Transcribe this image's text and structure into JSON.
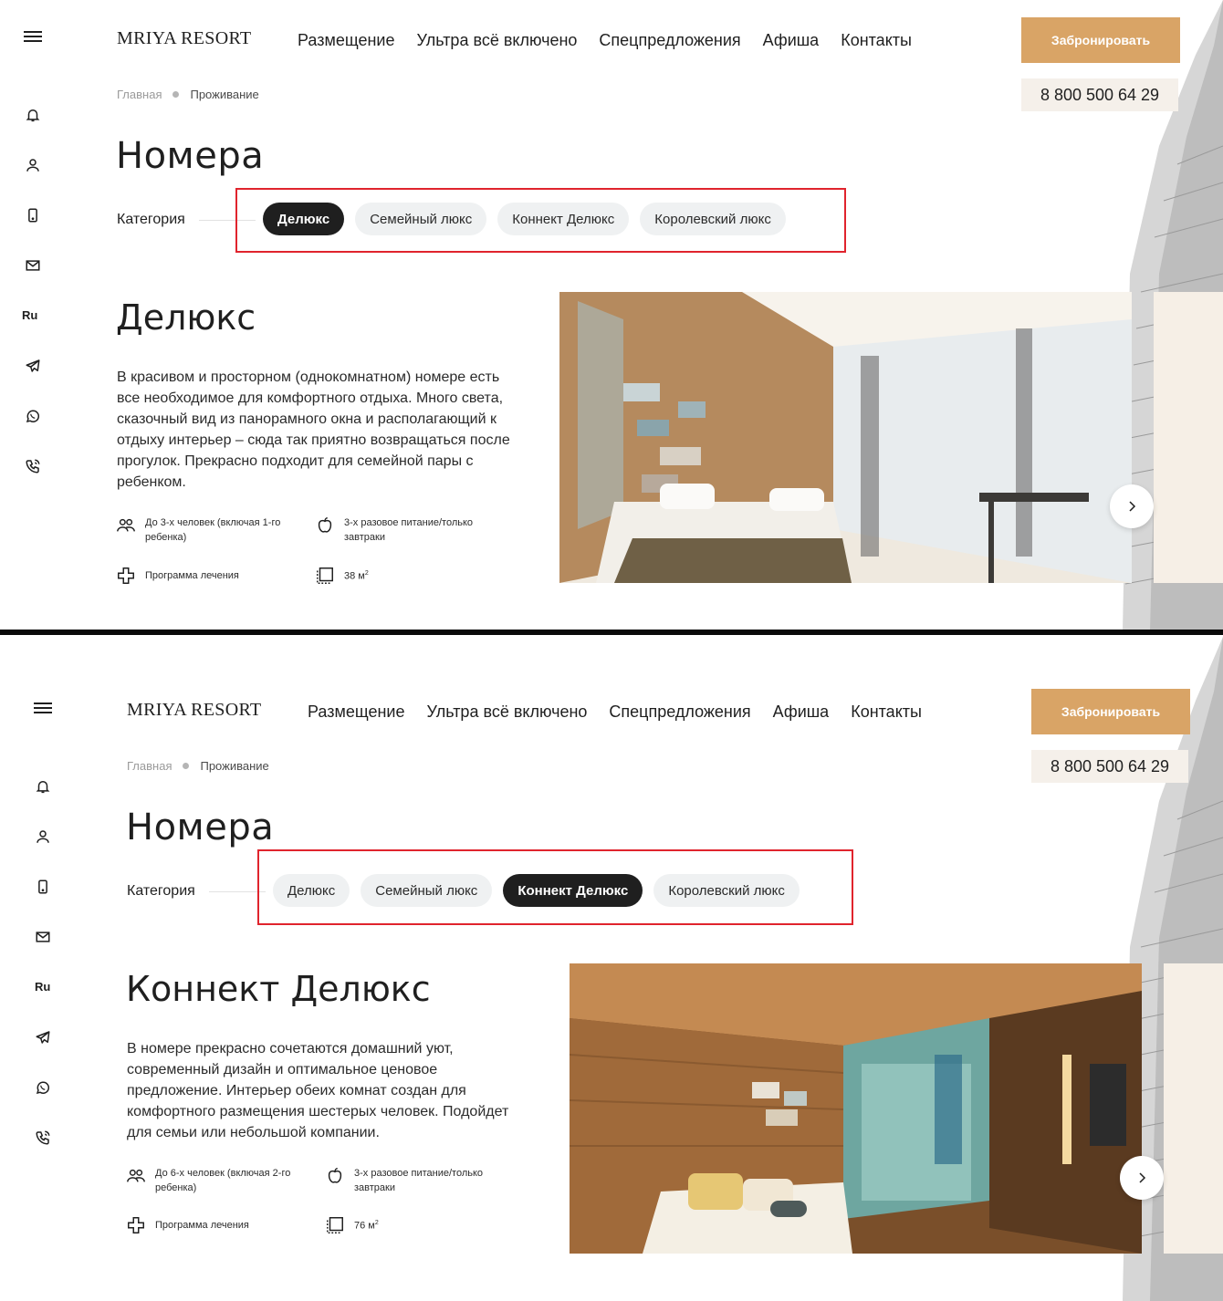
{
  "rail": {
    "lang": "Ru",
    "icons": [
      "menu-icon",
      "bell-icon",
      "user-icon",
      "mobile-icon",
      "mail-icon",
      "telegram-icon",
      "whatsapp-icon",
      "phone-call-icon"
    ]
  },
  "header": {
    "logo": "MRIYA RESORT",
    "nav": [
      "Размещение",
      "Ультра всё включено",
      "Спецпредложения",
      "Афиша",
      "Контакты"
    ],
    "book_label": "Забронировать",
    "phone": "8 800 500 64 29"
  },
  "breadcrumb": {
    "home": "Главная",
    "current": "Проживание"
  },
  "page_title": "Номера",
  "category_label": "Категория",
  "categories": [
    "Делюкс",
    "Семейный люкс",
    "Коннект Делюкс",
    "Королевский люкс"
  ],
  "colors": {
    "accent": "#d9a466",
    "active_pill": "#1f1f1f",
    "pill": "#eff1f2",
    "highlight": "#e0242d",
    "cream": "#f6efe6"
  },
  "screens": [
    {
      "active_category": "Делюкс",
      "room": {
        "title": "Делюкс",
        "description": "В красивом и просторном (однокомнатном) номере есть все необходимое для комфортного отдыха. Много света, сказочный вид из панорамного окна и располагающий к отдыху интерьер – сюда так приятно возвращаться после прогулок. Прекрасно подходит для семейной пары с ребенком.",
        "features": {
          "guests": "До 3-х человек (включая 1-го ребенка)",
          "meals": "3-х разовое питание/только завтраки",
          "program": "Программа лечения",
          "area": "38 м",
          "area_unit_sup": "2"
        }
      }
    },
    {
      "active_category": "Коннект Делюкс",
      "room": {
        "title": "Коннект Делюкс",
        "description": "В номере прекрасно сочетаются домашний уют, современный дизайн и оптимальное ценовое предложение. Интерьер обеих комнат создан для комфортного размещения шестерых человек. Подойдет для семьи или небольшой компании.",
        "features": {
          "guests": "До 6-х человек (включая 2-го ребенка)",
          "meals": "3-х разовое питание/только завтраки",
          "program": "Программа лечения",
          "area": "76 м",
          "area_unit_sup": "2"
        }
      }
    }
  ]
}
